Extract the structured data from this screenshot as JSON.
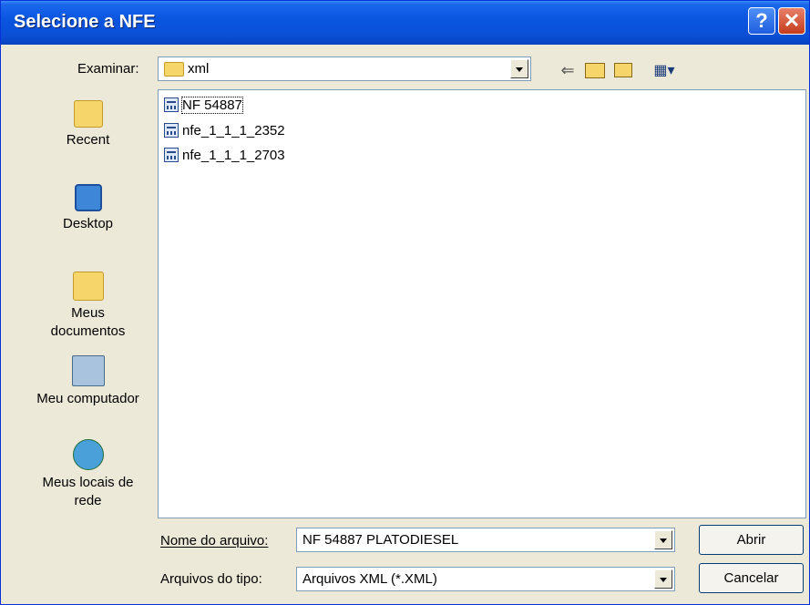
{
  "window": {
    "title": "Selecione a NFE",
    "help_glyph": "?",
    "close_glyph": "✕"
  },
  "lookin": {
    "label": "Examinar:",
    "value": "xml"
  },
  "toolbar": {
    "back_glyph": "⇐",
    "up_glyph": "⬆",
    "newfolder_glyph": "✱",
    "views_glyph": "▦▾"
  },
  "places": [
    {
      "label": "Recent",
      "icon": "folder-recent-icon"
    },
    {
      "label": "Desktop",
      "icon": "desktop-icon"
    },
    {
      "label": "Meus documentos",
      "icon": "my-documents-icon"
    },
    {
      "label": "Meu computador",
      "icon": "my-computer-icon"
    },
    {
      "label": "Meus locais de rede",
      "icon": "network-places-icon"
    }
  ],
  "files": [
    {
      "name": "NF 54887",
      "selected": true
    },
    {
      "name": "nfe_1_1_1_2352",
      "selected": false
    },
    {
      "name": "nfe_1_1_1_2703",
      "selected": false
    }
  ],
  "filename": {
    "label": "Nome do arquivo:",
    "value": "NF 54887 PLATODIESEL"
  },
  "filetype": {
    "label": "Arquivos do tipo:",
    "value": "Arquivos XML (*.XML)"
  },
  "buttons": {
    "open": "Abrir",
    "cancel": "Cancelar"
  },
  "colors": {
    "title_bar": "#0a56e0",
    "dialog_bg": "#ece9d8",
    "close_button": "#c43c1c"
  }
}
